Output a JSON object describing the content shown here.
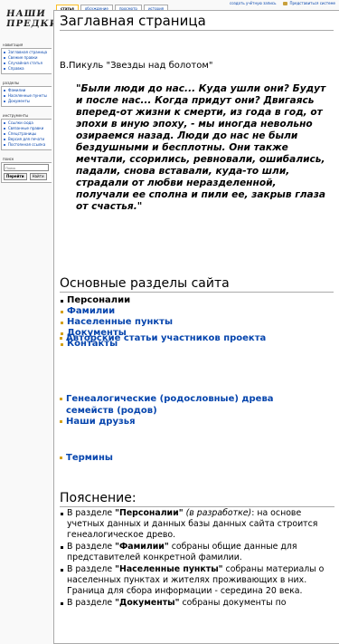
{
  "personal": {
    "create_account": "создать учётную запись",
    "login": "Представиться системе"
  },
  "tabs": [
    {
      "label": "статья"
    },
    {
      "label": "обсуждение"
    },
    {
      "label": "просмотр"
    },
    {
      "label": "история"
    }
  ],
  "logo": {
    "line1": "НАШИ",
    "line2": "ПРЕДКИ"
  },
  "sidebar": {
    "navigation": {
      "title": "навигация",
      "items": [
        "Заглавная страница",
        "Свежие правки",
        "Случайная статья",
        "Справка"
      ]
    },
    "sections": {
      "title": "разделы",
      "items": [
        "Фамилии",
        "Населенные пункты",
        "Документы"
      ]
    },
    "tools": {
      "title": "инструменты",
      "items": [
        "Ссылки сюда",
        "Связанные правки",
        "Спецстраницы",
        "Версия для печати",
        "Постоянная ссылка"
      ]
    },
    "search": {
      "title": "поиск",
      "placeholder": "Поиск",
      "go_label": "Перейти",
      "search_label": "Найти"
    }
  },
  "content": {
    "title": "Заглавная страница",
    "author": "В.Пикуль \"Звезды над болотом\"",
    "quote": "\"Были люди до нас... Куда ушли они? Будут и после нас... Когда придут они? Двигаясь вперед-от жизни к смерти, из года в год, от эпохи в иную эпоху, - мы иногда невольно озираемся назад. Люди до нас не были бездушными и бесплотны. Они также мечтали, ссорились, ревновали, ошибались, падали, снова вставали, куда-то шли, страдали от любви неразделенной, получали ее сполна и пили ее, закрыв глаза от счастья.\"",
    "sections_heading": "Основные разделы сайта",
    "sections": [
      "Персоналии",
      "Фамилии",
      "Населенные пункты",
      "Документы",
      "Контакты"
    ],
    "major_links": [
      "Авторские статьи участников проекта",
      "Генеалогические (родословные) древа семейств (родов)",
      "Наши друзья",
      "Термины"
    ],
    "explain_heading": "Пояснение:",
    "explain": [
      {
        "prefix": "В разделе ",
        "term": "\"Персоналии\"",
        "note": " (в разработке)",
        "rest": ": на основе учетных данных и данных базы данных сайта строится генеалогическое древо."
      },
      {
        "prefix": "В разделе ",
        "term": "\"Фамилии\"",
        "note": "",
        "rest": " собраны общие данные для представителей конкретной фамилии."
      },
      {
        "prefix": "В разделе ",
        "term": "\"Населенные пункты\"",
        "note": "",
        "rest": " собраны материалы о населенных пунктах и жителях проживающих в них. Граница для сбора информации - середина 20 века."
      },
      {
        "prefix": "В разделе ",
        "term": "\"Документы\"",
        "note": "",
        "rest": " собраны документы по"
      }
    ]
  }
}
